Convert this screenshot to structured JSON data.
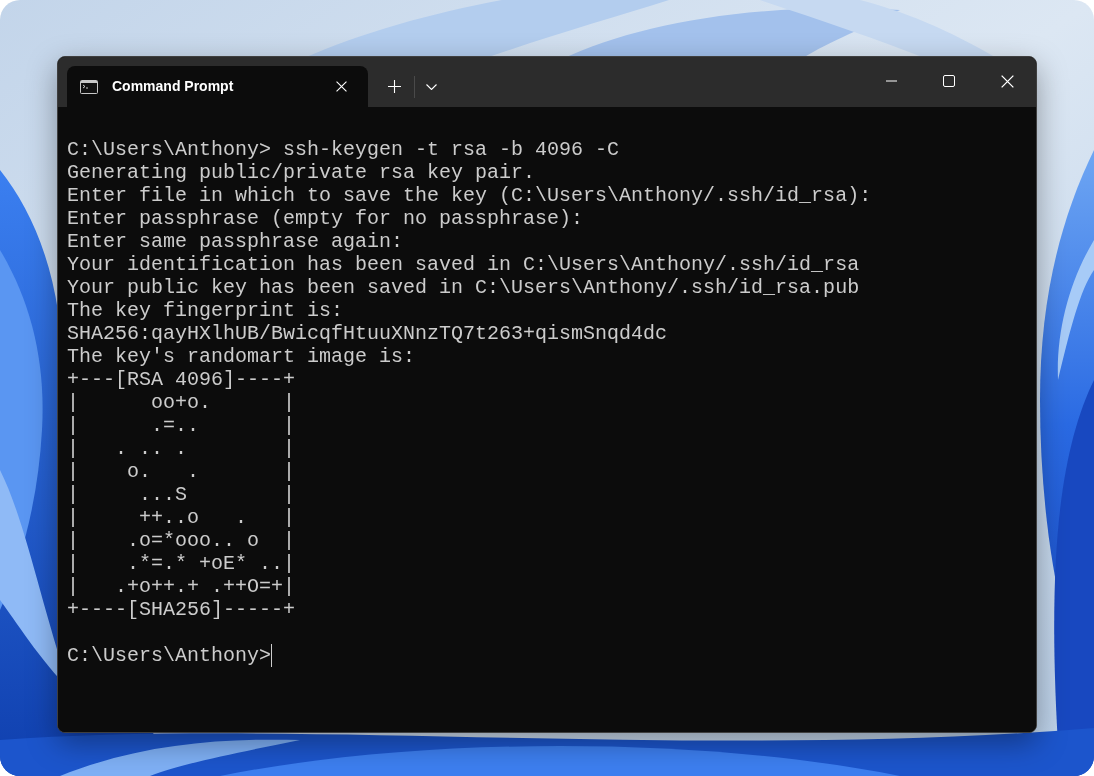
{
  "window": {
    "tabs": [
      {
        "title": "Command Prompt",
        "selected": true
      }
    ]
  },
  "terminal": {
    "command": "C:\\Users\\Anthony> ssh-keygen -t rsa -b 4096 -C",
    "output": [
      "Generating public/private rsa key pair.",
      "Enter file in which to save the key (C:\\Users\\Anthony/.ssh/id_rsa):",
      "Enter passphrase (empty for no passphrase):",
      "Enter same passphrase again:",
      "Your identification has been saved in C:\\Users\\Anthony/.ssh/id_rsa",
      "Your public key has been saved in C:\\Users\\Anthony/.ssh/id_rsa.pub",
      "The key fingerprint is:",
      "SHA256:qayHXlhUB/BwicqfHtuuXNnzTQ7t263+qismSnqd4dc",
      "The key's randomart image is:"
    ],
    "randomart": [
      "+---[RSA 4096]----+",
      "|      oo+o.      |",
      "|      .=..       |",
      "|   . .. .        |",
      "|    o.   .       |",
      "|     ...S        |",
      "|     ++..o   .   |",
      "|    .o=*ooo.. o  |",
      "|    .*=.* +oE* ..|",
      "|   .+o++.+ .++O=+|",
      "+----[SHA256]-----+"
    ],
    "prompt": "C:\\Users\\Anthony>",
    "cursor_visible": true
  }
}
